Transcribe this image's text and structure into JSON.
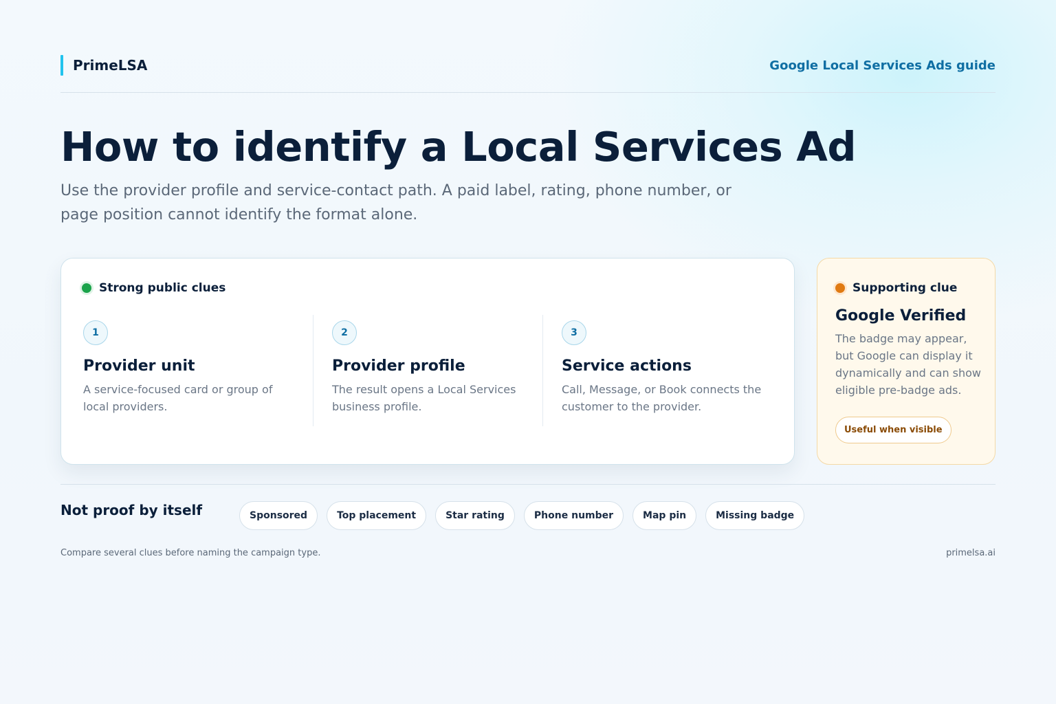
{
  "header": {
    "brand": "PrimeLSA",
    "guide_link": "Google Local Services Ads guide"
  },
  "hero": {
    "title": "How to identify a Local Services Ad",
    "subtitle": "Use the provider profile and service-contact path. A paid label, rating, phone number, or page position cannot identify the format alone."
  },
  "strong_clues": {
    "label": "Strong public clues",
    "dot_color": "#1aa34a",
    "steps": [
      {
        "number": "1",
        "title": "Provider unit",
        "description": "A service-focused card or group of local providers."
      },
      {
        "number": "2",
        "title": "Provider profile",
        "description": "The result opens a Local Services business profile."
      },
      {
        "number": "3",
        "title": "Service actions",
        "description": "Call, Message, or Book connects the customer to the provider."
      }
    ]
  },
  "supporting_clue": {
    "label": "Supporting clue",
    "dot_color": "#e07a12",
    "title": "Google Verified",
    "description": "The badge may appear, but Google can display it dynamically and can show eligible pre-badge ads.",
    "pill": "Useful when visible"
  },
  "not_proof": {
    "label": "Not proof by itself",
    "items": [
      "Sponsored",
      "Top placement",
      "Star rating",
      "Phone number",
      "Map pin",
      "Missing badge"
    ]
  },
  "footer": {
    "note": "Compare several clues before naming the campaign type.",
    "site": "primelsa.ai"
  },
  "colors": {
    "accent": "#22c3ee",
    "link": "#0f6ea3",
    "heading": "#0b1f3a"
  }
}
